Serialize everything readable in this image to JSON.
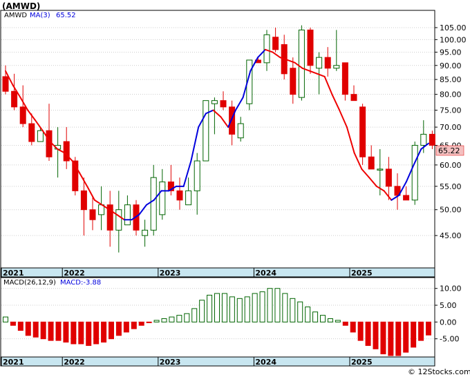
{
  "ticker": "(AMWD)",
  "watermark": "© 12Stocks.com",
  "price_panel": {
    "legend": {
      "symbol": "AMWD",
      "ma_label": "MA(3)",
      "ma_value": "65.52"
    },
    "last_price_label": "65.22",
    "y_ticks": [
      "105.00",
      "100.00",
      "95.00",
      "90.00",
      "85.00",
      "80.00",
      "75.00",
      "70.00",
      "65.00",
      "60.00",
      "55.00",
      "50.00",
      "45.00"
    ],
    "x_labels": [
      "2021",
      "2022",
      "2023",
      "2024",
      "2025"
    ]
  },
  "macd_panel": {
    "legend": {
      "title": "MACD(26,12,9)",
      "value_label": "MACD:-3.88"
    },
    "y_ticks": [
      "10.00",
      "5.00",
      "0.00",
      "-5.00"
    ],
    "x_labels": [
      "2021",
      "2022",
      "2023",
      "2024",
      "2025"
    ]
  },
  "colors": {
    "up": "#006400",
    "down": "#e00000",
    "ma_up": "#0000dd",
    "ma_down": "#ee0000",
    "axis_band": "#c8e6f0",
    "label_bg": "#f4c0c0"
  },
  "chart_data": [
    {
      "type": "candlestick",
      "scale": "log",
      "ylim": [
        40,
        108
      ],
      "x_labels": [
        "2021",
        "2022",
        "2023",
        "2024",
        "2025"
      ],
      "x_label_index": [
        0,
        7,
        18,
        29,
        40
      ],
      "series": [
        {
          "name": "AMWD",
          "ohlc": [
            [
              86,
              90,
              80,
              81
            ],
            [
              81,
              87,
              75,
              76
            ],
            [
              76,
              83,
              70,
              71
            ],
            [
              71,
              74,
              65,
              66
            ],
            [
              66,
              70,
              66,
              69
            ],
            [
              69,
              77,
              61,
              62
            ],
            [
              64,
              70,
              57,
              65
            ],
            [
              66,
              70,
              59,
              61
            ],
            [
              61,
              62,
              53,
              54
            ],
            [
              54,
              57,
              45,
              50
            ],
            [
              50,
              53,
              46,
              48
            ],
            [
              49,
              55,
              46,
              51
            ],
            [
              51,
              54,
              43,
              46
            ],
            [
              46,
              54,
              42,
              50
            ],
            [
              47,
              53,
              47,
              51
            ],
            [
              51,
              52,
              45,
              46
            ],
            [
              45,
              48,
              43,
              46
            ],
            [
              46,
              60,
              45,
              57
            ],
            [
              49,
              59,
              48,
              56
            ],
            [
              56,
              60,
              53,
              54
            ],
            [
              54,
              57,
              50,
              52
            ],
            [
              51,
              57,
              51,
              54
            ],
            [
              54,
              63,
              49,
              61
            ],
            [
              61,
              78,
              61,
              78
            ],
            [
              77,
              79,
              68,
              78
            ],
            [
              78,
              81,
              75,
              76
            ],
            [
              76,
              78,
              65,
              68
            ],
            [
              67,
              73,
              66,
              71
            ],
            [
              77,
              92,
              75,
              92
            ],
            [
              92,
              93,
              91,
              91
            ],
            [
              91,
              104,
              88,
              102
            ],
            [
              101,
              105,
              95,
              96
            ],
            [
              98,
              102,
              85,
              87
            ],
            [
              89,
              93,
              77,
              80
            ],
            [
              79,
              106,
              78,
              104
            ],
            [
              104,
              105,
              87,
              90
            ],
            [
              89,
              95,
              80,
              93
            ],
            [
              93,
              97,
              86,
              89
            ],
            [
              89,
              104,
              88,
              90
            ],
            [
              91,
              91,
              78,
              80
            ],
            [
              80,
              83,
              78,
              78
            ],
            [
              76,
              77,
              60,
              62
            ],
            [
              62,
              65,
              60,
              59
            ],
            [
              59,
              64,
              53,
              59
            ],
            [
              59,
              62,
              52,
              55
            ],
            [
              55,
              58,
              50,
              53
            ],
            [
              53,
              55,
              52,
              52
            ],
            [
              52,
              66,
              51,
              65
            ],
            [
              65,
              72,
              63,
              68
            ],
            [
              68,
              69,
              64,
              65
            ]
          ]
        },
        {
          "name": "MA(3)",
          "values": [
            88,
            83,
            79,
            75,
            72,
            69,
            66,
            64,
            63,
            61,
            58,
            55,
            52,
            51,
            50,
            49,
            48,
            48,
            49,
            51,
            52,
            54,
            54,
            55,
            55,
            61,
            70,
            74,
            75,
            73,
            70,
            75,
            79,
            88,
            93,
            96,
            95,
            93,
            92,
            91,
            89,
            88,
            87,
            86,
            80,
            75,
            70,
            63,
            59,
            57,
            55,
            54,
            52,
            53,
            56,
            60,
            64,
            65.5
          ]
        }
      ]
    },
    {
      "type": "bar",
      "title": "MACD(26,12,9)",
      "ylim": [
        -10,
        12
      ],
      "series": [
        {
          "name": "MACD",
          "values": [
            1.5,
            -1,
            -2.5,
            -4,
            -4.5,
            -5,
            -5.5,
            -5.5,
            -6,
            -6.5,
            -6.5,
            -7,
            -6.5,
            -6,
            -5,
            -4,
            -3,
            -2,
            -1,
            -0.2,
            0.5,
            1,
            1.5,
            2,
            2.5,
            4,
            6.5,
            8,
            8.5,
            8.5,
            7.5,
            7,
            7.5,
            8.5,
            9,
            10,
            10,
            8.5,
            7,
            6,
            4.5,
            3,
            2,
            1,
            0.5,
            -1,
            -3,
            -5.5,
            -7,
            -8,
            -9.5,
            -10,
            -10,
            -9,
            -7.5,
            -5.5,
            -3.88
          ]
        }
      ]
    }
  ]
}
